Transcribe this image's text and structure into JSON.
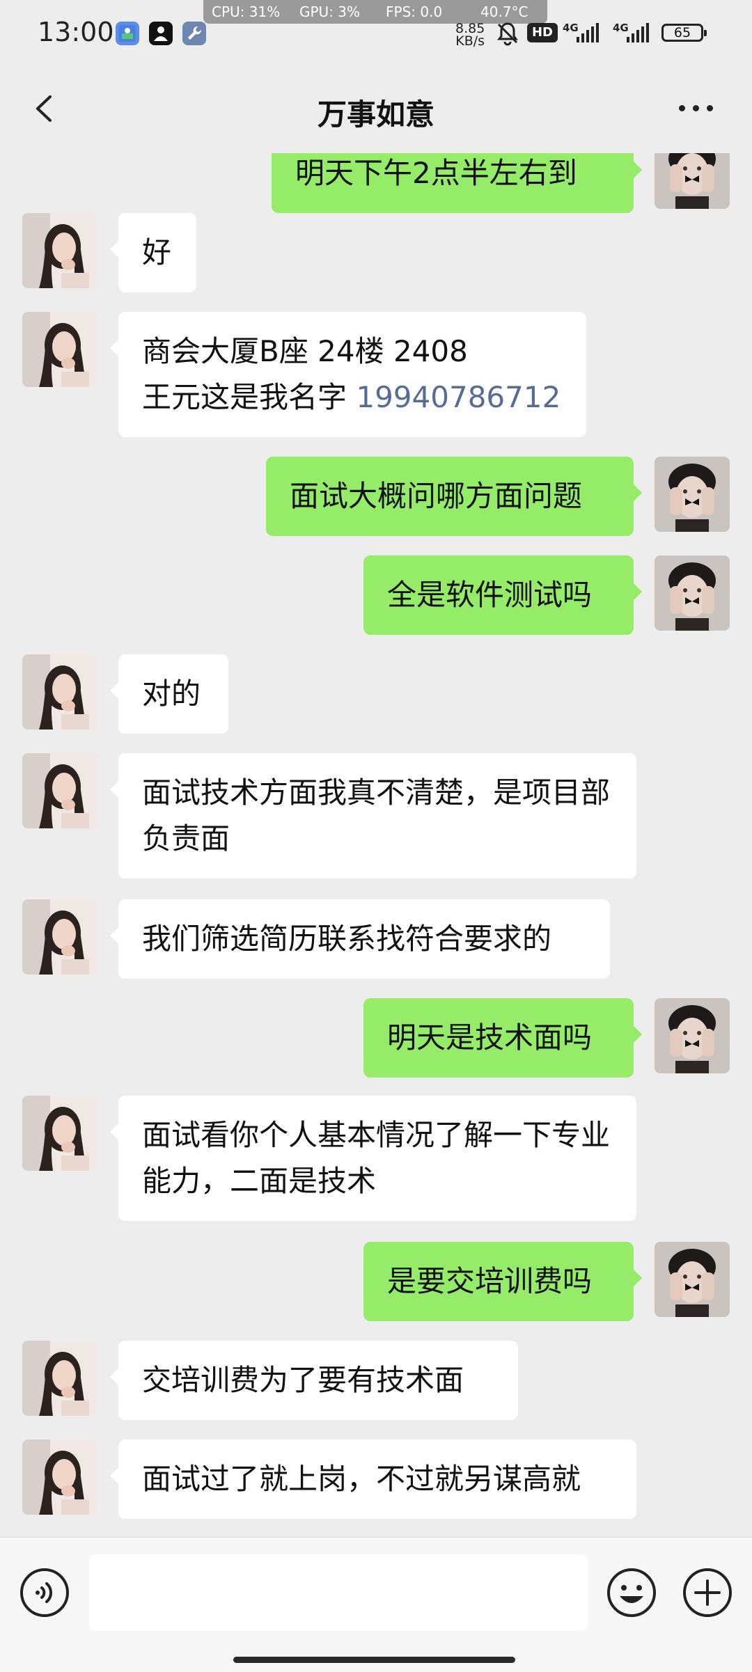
{
  "status_bar": {
    "perf_cpu": "CPU: 31%",
    "perf_gpu": "GPU: 3%",
    "perf_fps": "FPS: 0.0",
    "perf_temp": "40.7°C",
    "time": "13:00",
    "net_speed_value": "8.85",
    "net_speed_unit": "KB/s",
    "hd_label": "HD",
    "signal1_label": "4G",
    "signal2_label": "4G",
    "battery": "65"
  },
  "header": {
    "title": "万事如意"
  },
  "messages": [
    {
      "side": "out",
      "text": "明天下午2点半左右到"
    },
    {
      "side": "in",
      "text": "好"
    },
    {
      "side": "in",
      "text": "商会大厦B座 24楼 2408",
      "text2": "王元这是我名字 ",
      "phone": "19940786712"
    },
    {
      "side": "out",
      "text": "面试大概问哪方面问题"
    },
    {
      "side": "out",
      "text": "全是软件测试吗"
    },
    {
      "side": "in",
      "text": "对的"
    },
    {
      "side": "in",
      "text": "面试技术方面我真不清楚，是项目部负责面"
    },
    {
      "side": "in",
      "text": "我们筛选简历联系找符合要求的"
    },
    {
      "side": "out",
      "text": "明天是技术面吗"
    },
    {
      "side": "in",
      "text": "面试看你个人基本情况了解一下专业能力，二面是技术"
    },
    {
      "side": "out",
      "text": "是要交培训费吗"
    },
    {
      "side": "in",
      "text": "交培训费为了要有技术面"
    },
    {
      "side": "in",
      "text": "面试过了就上岗，不过就另谋高就"
    }
  ],
  "input_bar": {
    "placeholder": "",
    "voice_icon": "voice-icon",
    "emoji_icon": "emoji-icon",
    "plus_icon": "plus-icon"
  },
  "colors": {
    "background": "#ededed",
    "bubble_out": "#95ec69",
    "bubble_in": "#ffffff",
    "link": "#576b95"
  }
}
